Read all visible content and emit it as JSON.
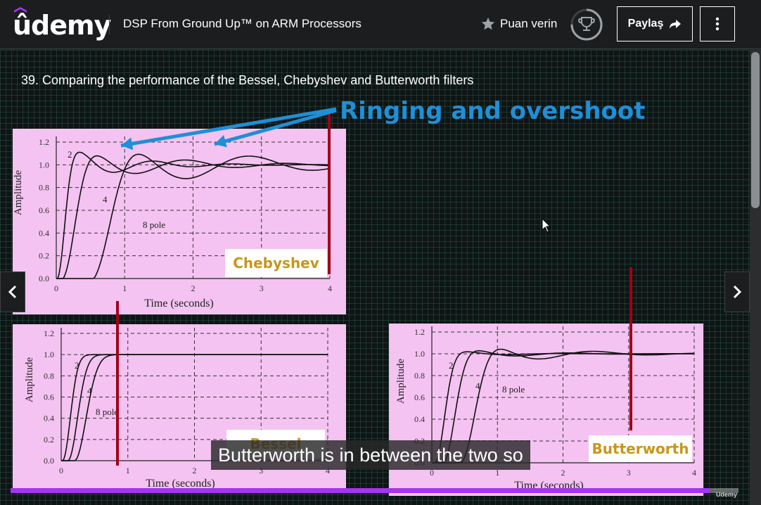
{
  "header": {
    "logo_text": "ûdemy",
    "course_title": "DSP From Ground Up™ on ARM Processors",
    "rate_label": "Puan verin",
    "share_label": "Paylaş",
    "progress_fraction": 0.75
  },
  "lecture": {
    "title": "39. Comparing the performance of the Bessel, Chebyshev and Butterworth filters",
    "slide_heading": "Ringing and overshoot",
    "caption": "Butterworth is in between the two so",
    "watermark": "Udemy",
    "playback_progress": 0.96
  },
  "colors": {
    "accent": "#a435f0",
    "heading_blue": "#1f8fd6",
    "panel_pink": "#f4c3f1",
    "marker_red": "#a00018",
    "label_gold": "#c8961a"
  },
  "chart_data": [
    {
      "type": "line",
      "title": "Chebyshev",
      "xlabel": "Time (seconds)",
      "ylabel": "Amplitude",
      "xlim": [
        0,
        4
      ],
      "ylim": [
        0,
        1.2
      ],
      "x_ticks": [
        "0",
        "1",
        "2",
        "3",
        "4"
      ],
      "y_ticks": [
        "0.0",
        "0.2",
        "0.4",
        "0.6",
        "0.8",
        "1.0",
        "1.2"
      ],
      "grid": true,
      "series_labels": [
        "2",
        "4",
        "8 pole"
      ]
    },
    {
      "type": "line",
      "title": "Bessel",
      "xlabel": "Time (seconds)",
      "ylabel": "Amplitude",
      "xlim": [
        0,
        4
      ],
      "ylim": [
        0,
        1.2
      ],
      "x_ticks": [
        "0",
        "1",
        "2",
        "3",
        "4"
      ],
      "y_ticks": [
        "0.0",
        "0.2",
        "0.4",
        "0.6",
        "0.8",
        "1.0",
        "1.2"
      ],
      "grid": true,
      "series_labels": [
        "2",
        "4",
        "8 pole"
      ]
    },
    {
      "type": "line",
      "title": "Butterworth",
      "xlabel": "Time (seconds)",
      "ylabel": "Amplitude",
      "xlim": [
        0,
        4
      ],
      "ylim": [
        0,
        1.2
      ],
      "x_ticks": [
        "0",
        "1",
        "2",
        "3",
        "4"
      ],
      "y_ticks": [
        "0.0",
        "0.2",
        "0.4",
        "0.6",
        "0.8",
        "1.0",
        "1.2"
      ],
      "grid": true,
      "series_labels": [
        "2",
        "4",
        "8 pole"
      ]
    }
  ]
}
